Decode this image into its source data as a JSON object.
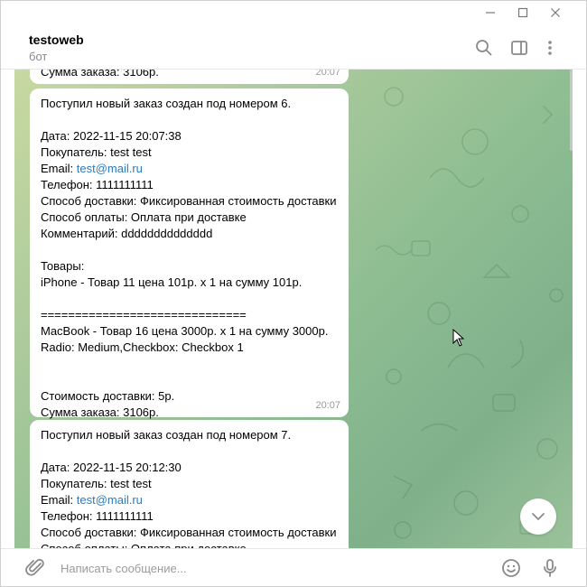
{
  "chat": {
    "title": "testoweb",
    "subtitle": "бот"
  },
  "composer": {
    "placeholder": "Написать сообщение..."
  },
  "messages": {
    "prev": {
      "text": "Сумма заказа: 3106р.",
      "time": "20:07"
    },
    "order6": {
      "header": "Поступил новый заказ создан под номером 6.",
      "date": "Дата: 2022-11-15 20:07:38",
      "buyer": "Покупатель: test test",
      "email_label": "Email: ",
      "email_link": "test@mail.ru",
      "phone": "Телефон: 1111111111",
      "delivery": "Способ доставки: Фиксированная стоимость доставки",
      "payment": "Способ оплаты: Оплата при доставке",
      "comment": "Комментарий: dddddddddddddd",
      "goods_label": "Товары:",
      "item1": "iPhone - Товар 11 цена 101р. х 1 на сумму 101р.",
      "separator": "==============================",
      "item2": "MacBook - Товар 16 цена 3000р. х 1 на сумму 3000р.",
      "options": "Radio: Medium,Checkbox: Checkbox 1",
      "shipping_cost": "Стоимость доставки: 5р.",
      "total": "Сумма заказа: 3106р.",
      "time": "20:07"
    },
    "order7": {
      "header": "Поступил новый заказ создан под номером 7.",
      "date": "Дата: 2022-11-15 20:12:30",
      "buyer": "Покупатель: test test",
      "email_label": "Email: ",
      "email_link": "test@mail.ru",
      "phone": "Телефон: 1111111111",
      "delivery": "Способ доставки: Фиксированная стоимость доставки",
      "payment": "Способ оплаты: Оплата при доставке"
    }
  },
  "colors": {
    "link": "#2b7bbf",
    "wallpaper_start": "#c8d9a2",
    "wallpaper_end": "#7fb08a"
  },
  "icons": {
    "window_minimize": "minimize-icon",
    "window_maximize": "maximize-icon",
    "window_close": "close-icon",
    "search": "search-icon",
    "sidebar": "sidebar-toggle-icon",
    "more": "more-vertical-icon",
    "scroll_down": "chevron-down-icon",
    "attach": "paperclip-icon",
    "emoji": "smile-icon",
    "voice": "microphone-icon"
  }
}
